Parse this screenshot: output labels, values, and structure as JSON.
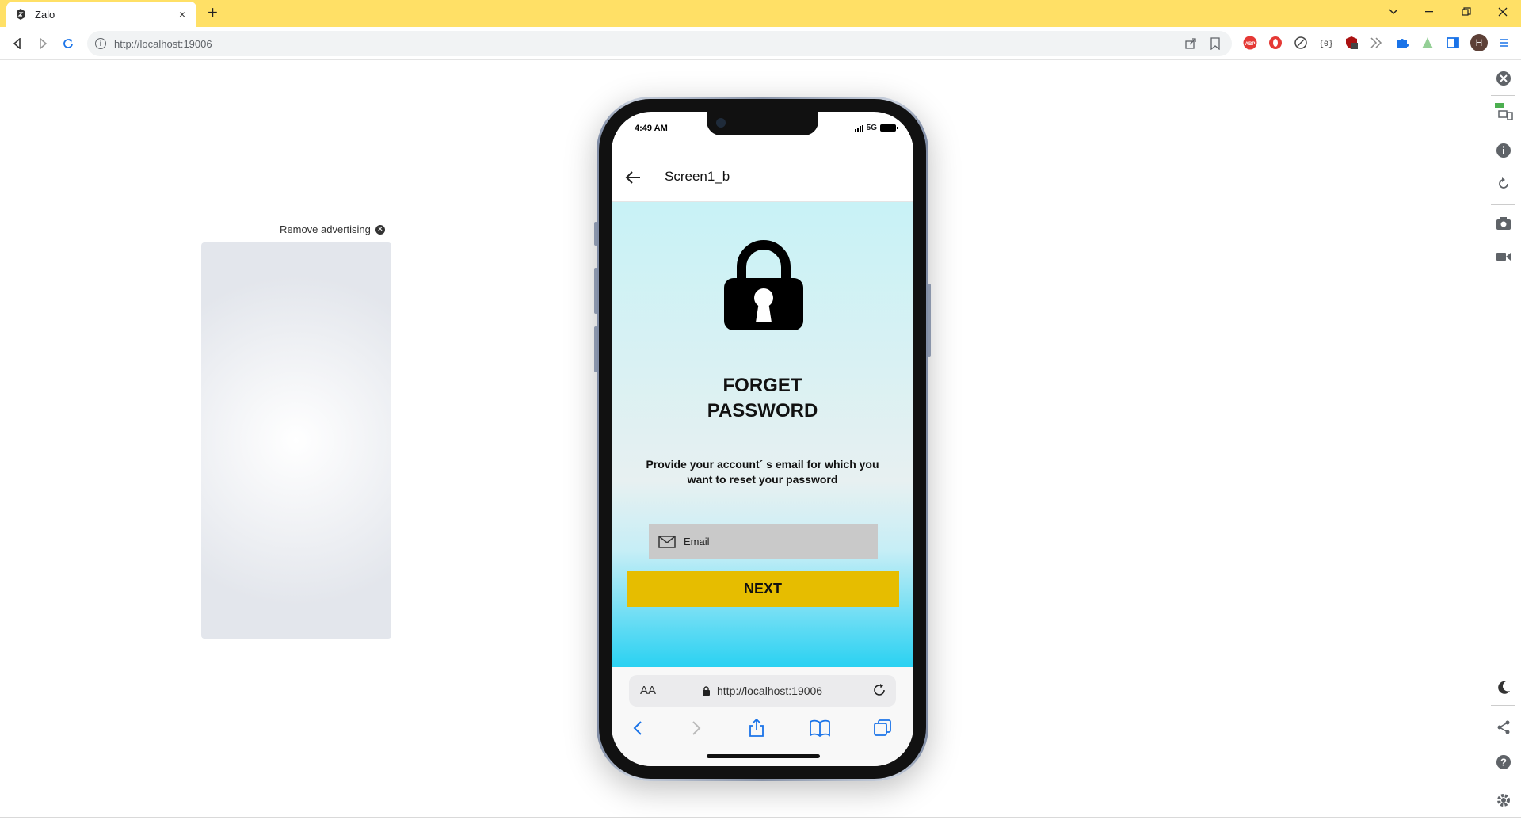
{
  "browser": {
    "tab_title": "Zalo",
    "tab_close": "×",
    "new_tab": "+",
    "url": "http://localhost:19006",
    "accent_color": "#ffe066"
  },
  "extensions": [
    "abp-icon",
    "opera-icon",
    "extension-icon",
    "code-icon",
    "ublock-icon",
    "arrows-icon",
    "puzzle-icon",
    "person-icon",
    "sidepanel-icon"
  ],
  "profile_initial": "H",
  "ad": {
    "remove_label": "Remove advertising"
  },
  "phone": {
    "status_time": "4:49 AM",
    "network": "5G",
    "screen_title": "Screen1_b",
    "heading_line1": "FORGET",
    "heading_line2": "PASSWORD",
    "description": "Provide your account´ s email for which you want to reset your password",
    "email_placeholder": "Email",
    "next_label": "NEXT",
    "button_color": "#e6bd00",
    "safari_aa": "AA",
    "safari_url": "http://localhost:19006"
  }
}
